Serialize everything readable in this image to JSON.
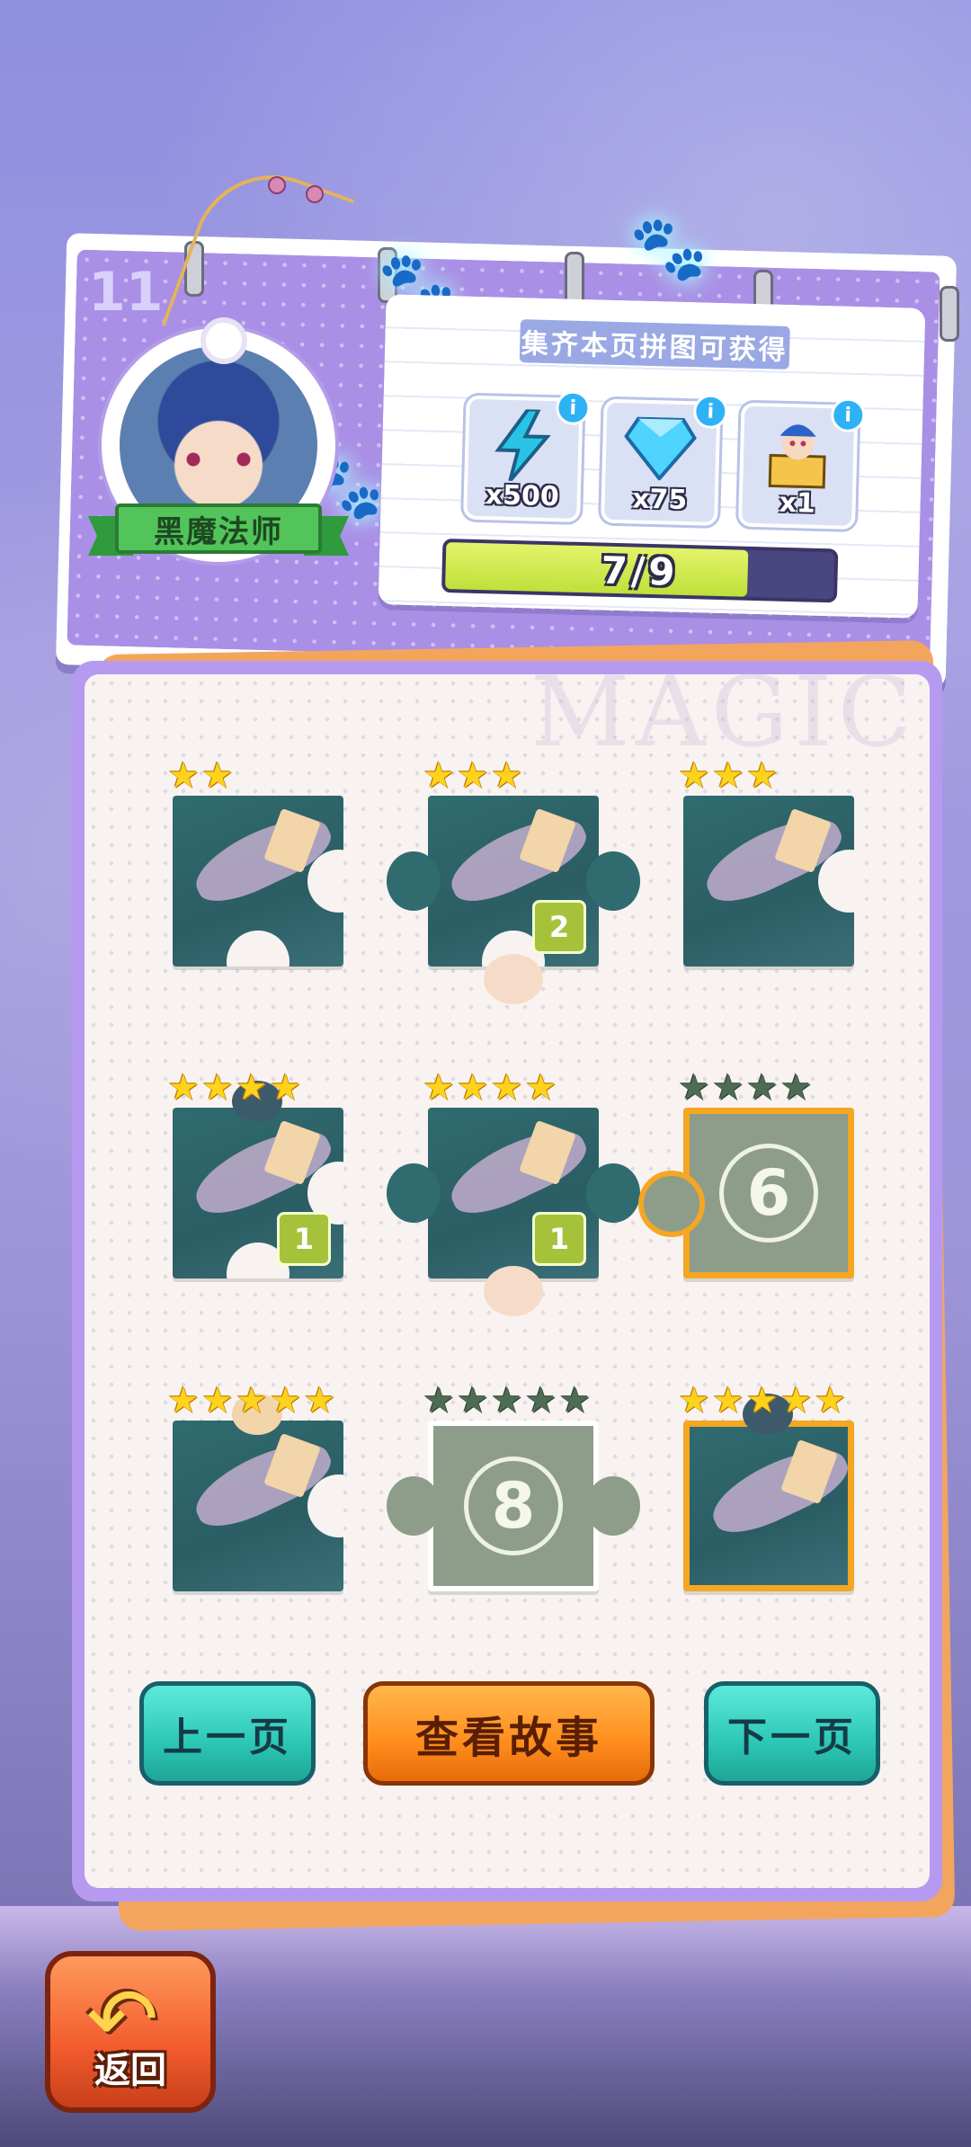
{
  "page": {
    "number": "11",
    "character_name": "黑魔法师",
    "watermark": "MAGIC"
  },
  "rewards": {
    "title": "集齐本页拼图可获得",
    "items": [
      {
        "name": "energy",
        "icon": "lightning-icon",
        "count": "x500"
      },
      {
        "name": "diamond",
        "icon": "diamond-icon",
        "count": "x75"
      },
      {
        "name": "jester-box",
        "icon": "jester-gift-icon",
        "count": "x1"
      }
    ],
    "info_symbol": "i",
    "progress_text": "7/9",
    "progress_collected": 7,
    "progress_total": 9
  },
  "puzzle": {
    "pieces": [
      {
        "id": 1,
        "stars": 2,
        "max_stars": 2,
        "state": "collected",
        "count": "",
        "lock_number": ""
      },
      {
        "id": 2,
        "stars": 3,
        "max_stars": 3,
        "state": "collected",
        "count": "2",
        "lock_number": ""
      },
      {
        "id": 3,
        "stars": 3,
        "max_stars": 3,
        "state": "collected",
        "count": "",
        "lock_number": ""
      },
      {
        "id": 4,
        "stars": 4,
        "max_stars": 4,
        "state": "collected",
        "count": "1",
        "lock_number": ""
      },
      {
        "id": 5,
        "stars": 4,
        "max_stars": 4,
        "state": "collected",
        "count": "1",
        "lock_number": ""
      },
      {
        "id": 6,
        "stars": 0,
        "max_stars": 4,
        "state": "locked",
        "count": "",
        "lock_number": "6"
      },
      {
        "id": 7,
        "stars": 5,
        "max_stars": 5,
        "state": "collected",
        "count": "",
        "lock_number": ""
      },
      {
        "id": 8,
        "stars": 0,
        "max_stars": 5,
        "state": "locked",
        "count": "",
        "lock_number": "8"
      },
      {
        "id": 9,
        "stars": 5,
        "max_stars": 5,
        "state": "collected",
        "count": "",
        "lock_number": ""
      }
    ]
  },
  "buttons": {
    "prev": "上一页",
    "story": "查看故事",
    "next": "下一页",
    "back": "返回"
  },
  "colors": {
    "accent_orange": "#ff8d1d",
    "accent_teal": "#2cc7b6",
    "progress_fill": "#bfe03a",
    "star_gold": "#ffd21c",
    "locked_piece": "#8d9d8a"
  }
}
